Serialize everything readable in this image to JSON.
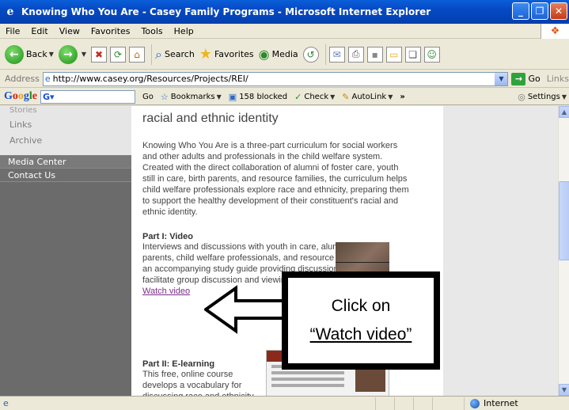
{
  "window": {
    "title": "Knowing Who You Are - Casey Family Programs - Microsoft Internet Explorer"
  },
  "menu": [
    "File",
    "Edit",
    "View",
    "Favorites",
    "Tools",
    "Help"
  ],
  "toolbar": {
    "back": "Back",
    "search": "Search",
    "favorites": "Favorites",
    "media": "Media"
  },
  "address": {
    "label": "Address",
    "url": "http://www.casey.org/Resources/Projects/REI/",
    "go": "Go",
    "links": "Links"
  },
  "googlebar": {
    "go": "Go",
    "bookmarks": "Bookmarks",
    "blocked": "158 blocked",
    "check": "Check",
    "autolink": "AutoLink",
    "settings": "Settings"
  },
  "sidebar": {
    "partial_item": "Stories",
    "links": [
      "Links",
      "Archive"
    ],
    "nav": [
      "Media Center",
      "Contact Us"
    ]
  },
  "content": {
    "heading": "racial and ethnic identity",
    "intro": "Knowing Who You Are is a three-part curriculum for social workers and other adults and professionals in the child welfare system. Created with the direct collaboration of alumni of foster care, youth still in care, birth parents, and resource families, the curriculum helps child welfare professionals explore race and ethnicity, preparing them to support the healthy development of their constituent's racial and ethnic identity.",
    "part1_title": "Part I: Video",
    "part1_text": "Interviews and discussions with youth in care, alumni, birth parents, child welfare professionals, and resource families, with an accompanying study guide providing discussion questions to facilitate group discussion and viewing.",
    "watch_video": "Watch video",
    "part2_title": "Part II: E-learning",
    "part2_text": "This free, online course develops a vocabulary for discussing race and ethnicity"
  },
  "callout": {
    "line1": "Click on",
    "line2": "“Watch video”"
  },
  "status": {
    "zone": "Internet"
  }
}
